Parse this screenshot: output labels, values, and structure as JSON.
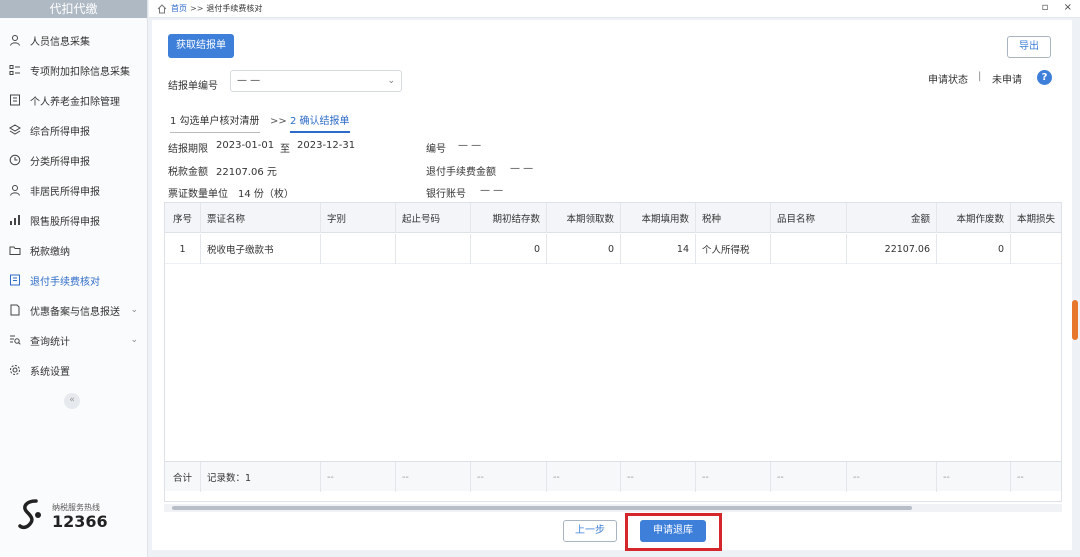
{
  "sidebar": {
    "title": "代扣代缴",
    "items": [
      {
        "label": "人员信息采集",
        "icon": "person-icon"
      },
      {
        "label": "专项附加扣除信息采集",
        "icon": "list-icon"
      },
      {
        "label": "个人养老金扣除管理",
        "icon": "pension-icon"
      },
      {
        "label": "综合所得申报",
        "icon": "layers-icon"
      },
      {
        "label": "分类所得申报",
        "icon": "clock-icon"
      },
      {
        "label": "非居民所得申报",
        "icon": "person-icon"
      },
      {
        "label": "限售股所得申报",
        "icon": "bar-chart-icon"
      },
      {
        "label": "税款缴纳",
        "icon": "folder-icon"
      },
      {
        "label": "退付手续费核对",
        "icon": "document-icon",
        "active": true
      },
      {
        "label": "优惠备案与信息报送",
        "icon": "file-icon",
        "expandable": true
      },
      {
        "label": "查询统计",
        "icon": "search-list-icon",
        "expandable": true
      },
      {
        "label": "系统设置",
        "icon": "gear-icon"
      }
    ],
    "collapse": "«",
    "hotline_label": "纳税服务热线",
    "hotline_number": "12366"
  },
  "topbar": {
    "home": "首页",
    "separator": ">>",
    "current": "退付手续费核对",
    "win_restore": "▫",
    "win_close": "×"
  },
  "toolbar": {
    "fetch_button": "获取结报单",
    "export_button": "导出"
  },
  "filter": {
    "statement_no_label": "结报单编号",
    "statement_no_value": "— —"
  },
  "status": {
    "label": "申请状态",
    "separator": "|",
    "value": "未申请",
    "help": "?"
  },
  "steps": {
    "step1": "1 勾选单户核对清册",
    "arrow": ">>",
    "step2": "2 确认结报单"
  },
  "info": {
    "period_label": "结报期限",
    "period_start": "2023-01-01",
    "period_to": "至",
    "period_end": "2023-12-31",
    "tax_amount_label": "税款金额",
    "tax_amount": "22107.06 元",
    "ticket_count_label": "票证数量单位",
    "ticket_count": "14 份（枚）",
    "code_label": "编号",
    "code_value": "— —",
    "refund_fee_label": "退付手续费金额",
    "refund_fee_value": "— —",
    "bank_account_label": "银行账号",
    "bank_account_value": "— —"
  },
  "table": {
    "columns": [
      "序号",
      "票证名称",
      "字别",
      "起止号码",
      "期初结存数",
      "本期领取数",
      "本期填用数",
      "税种",
      "品目名称",
      "金额",
      "本期作废数",
      "本期损失"
    ],
    "rows": [
      [
        "1",
        "税收电子缴款书",
        "",
        "",
        "0",
        "0",
        "14",
        "个人所得税",
        "",
        "22107.06",
        "0",
        ""
      ]
    ],
    "footer": {
      "total_label": "合计",
      "record_count": "记录数：1",
      "dash": "--"
    }
  },
  "actions": {
    "prev_button": "上一步",
    "apply_button": "申请退库"
  },
  "colors": {
    "accent": "#3d7fd9",
    "highlight_frame": "#d4262b"
  }
}
